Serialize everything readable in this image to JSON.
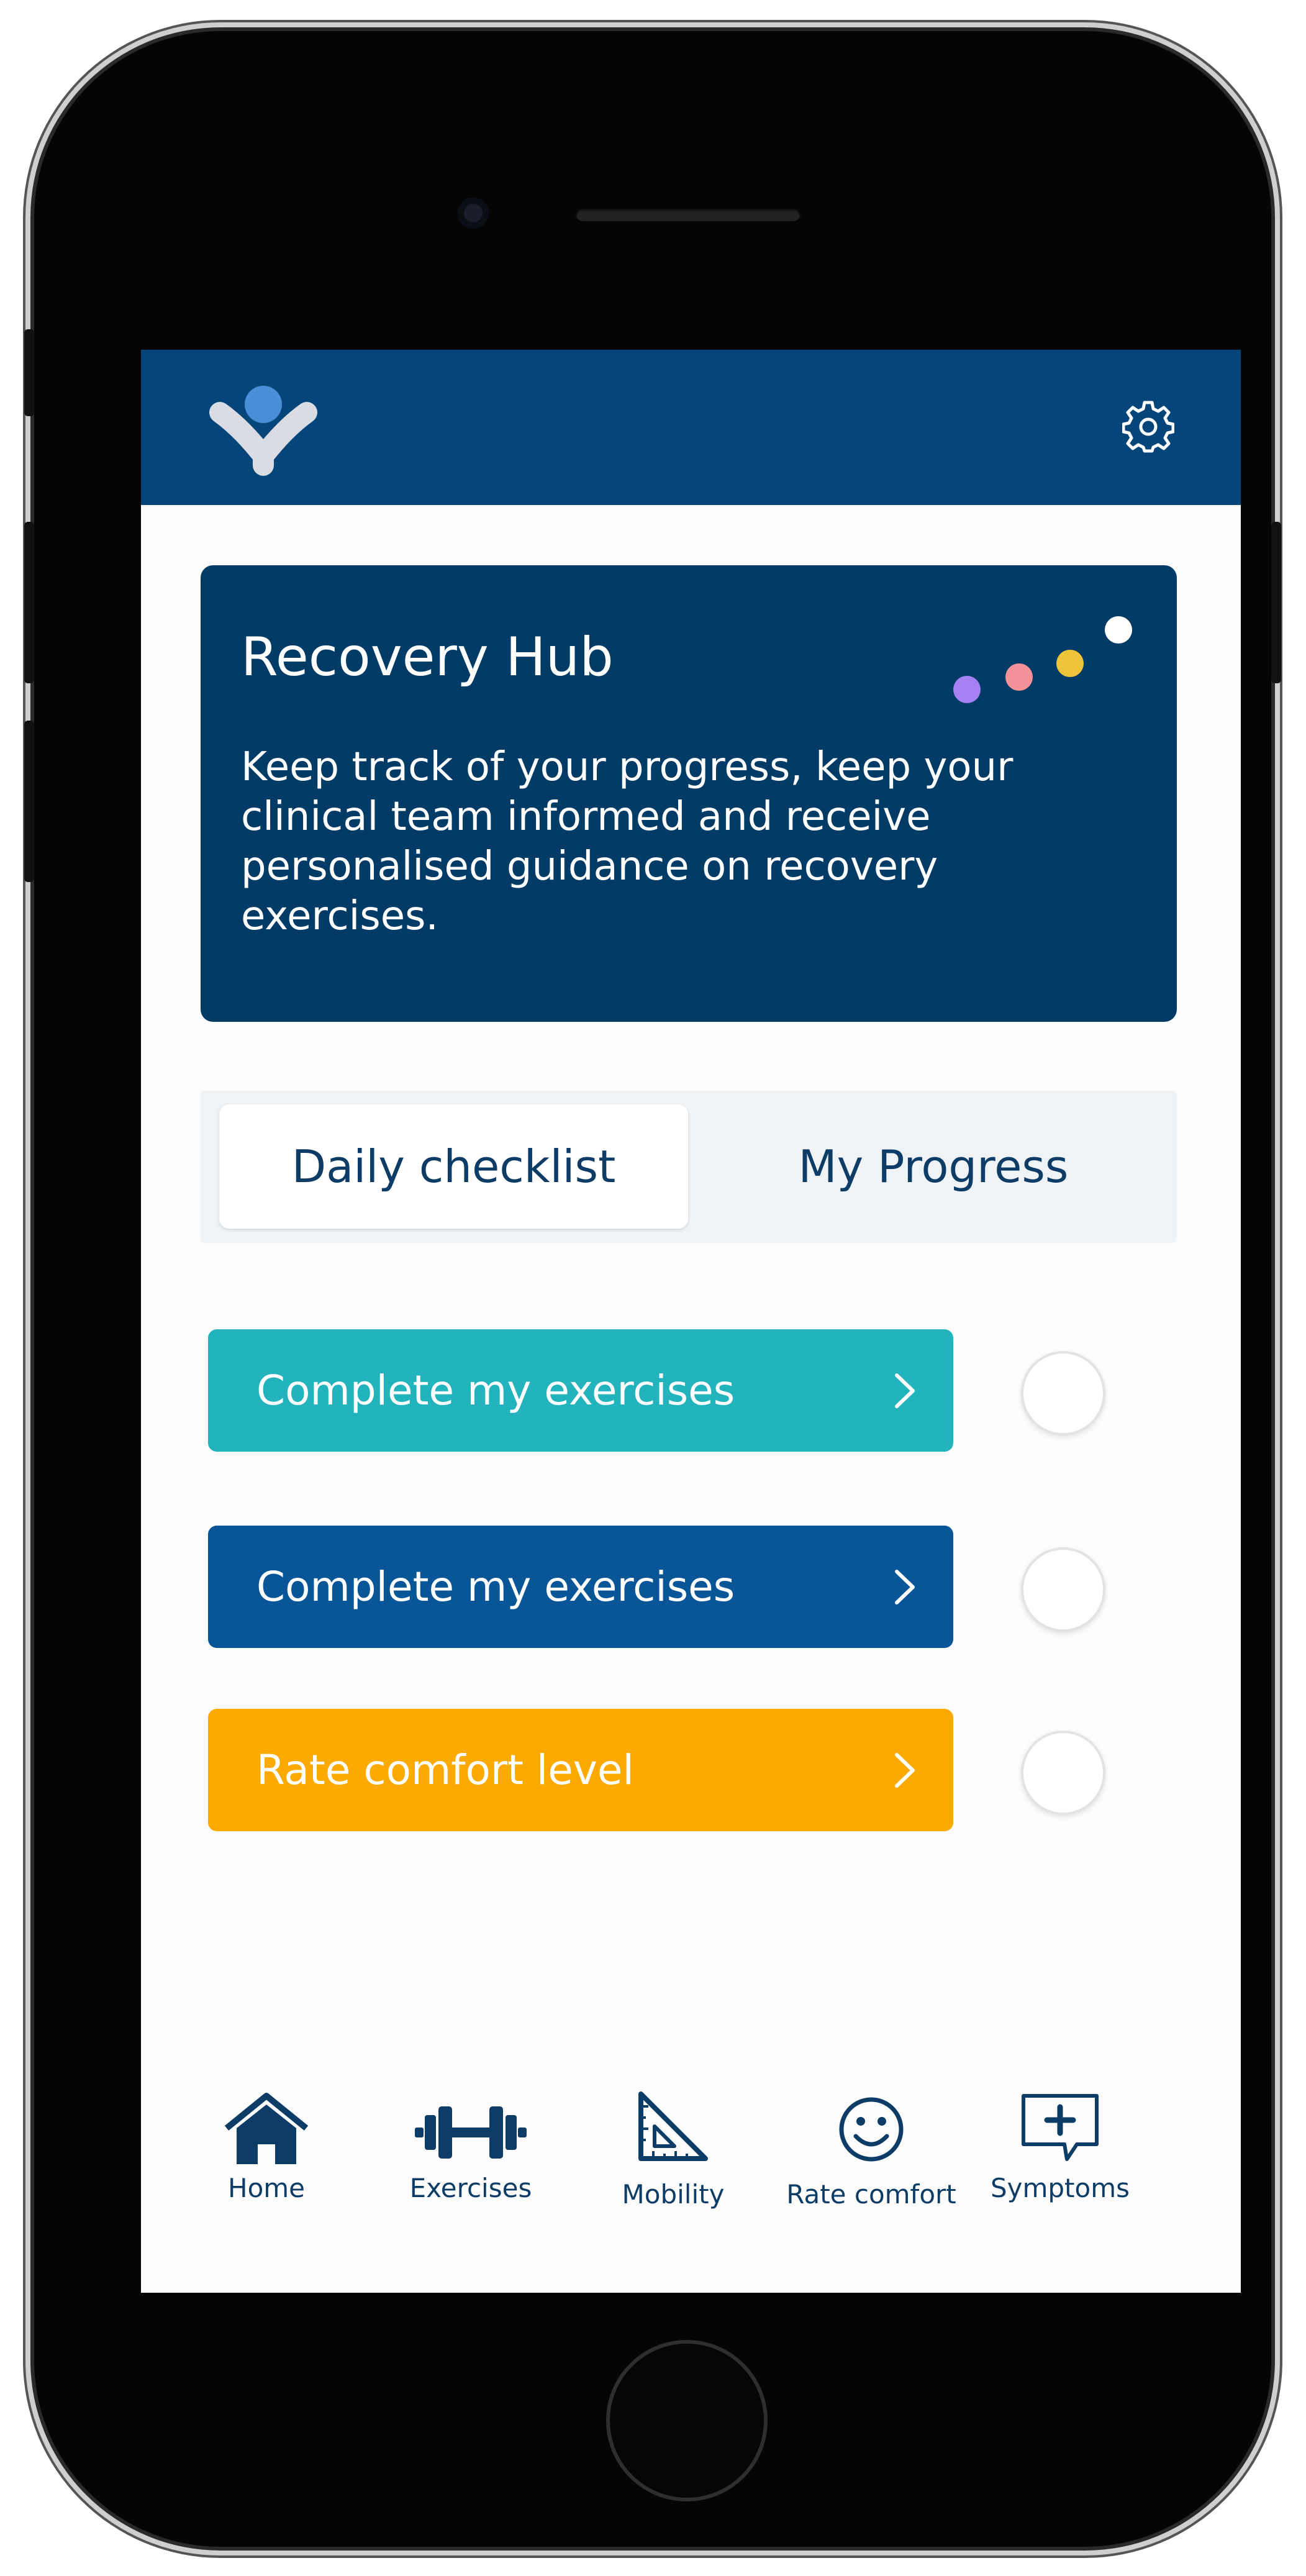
{
  "colors": {
    "brand_navy": "#06457a",
    "hero_navy": "#023b66",
    "text_navy": "#0d3c66",
    "teal": "#22b3bc",
    "blue": "#085697",
    "amber": "#fca900",
    "dot_purple": "#a480f2",
    "dot_pink": "#f4929a",
    "dot_yellow": "#eec43a",
    "dot_white": "#ffffff"
  },
  "header": {
    "logo_icon": "brand-logo-icon",
    "settings_icon": "gear-icon"
  },
  "hero": {
    "title": "Recovery Hub",
    "body": "Keep track of your progress, keep your clinical team informed and receive personalised guidance on recovery exercises."
  },
  "tabs": [
    {
      "label": "Daily checklist",
      "active": true
    },
    {
      "label": "My Progress",
      "active": false
    }
  ],
  "checklist": [
    {
      "label": "Complete my exercises",
      "color": "#22b3bc",
      "done": false
    },
    {
      "label": "Complete my exercises",
      "color": "#085697",
      "done": false
    },
    {
      "label": "Rate comfort level",
      "color": "#fca900",
      "done": false
    }
  ],
  "nav": [
    {
      "label": "Home",
      "icon": "home-icon"
    },
    {
      "label": "Exercises",
      "icon": "dumbbell-icon"
    },
    {
      "label": "Mobility",
      "icon": "set-square-icon"
    },
    {
      "label": "Rate comfort",
      "icon": "smiley-icon"
    },
    {
      "label": "Symptoms",
      "icon": "symptom-chat-plus-icon"
    }
  ]
}
